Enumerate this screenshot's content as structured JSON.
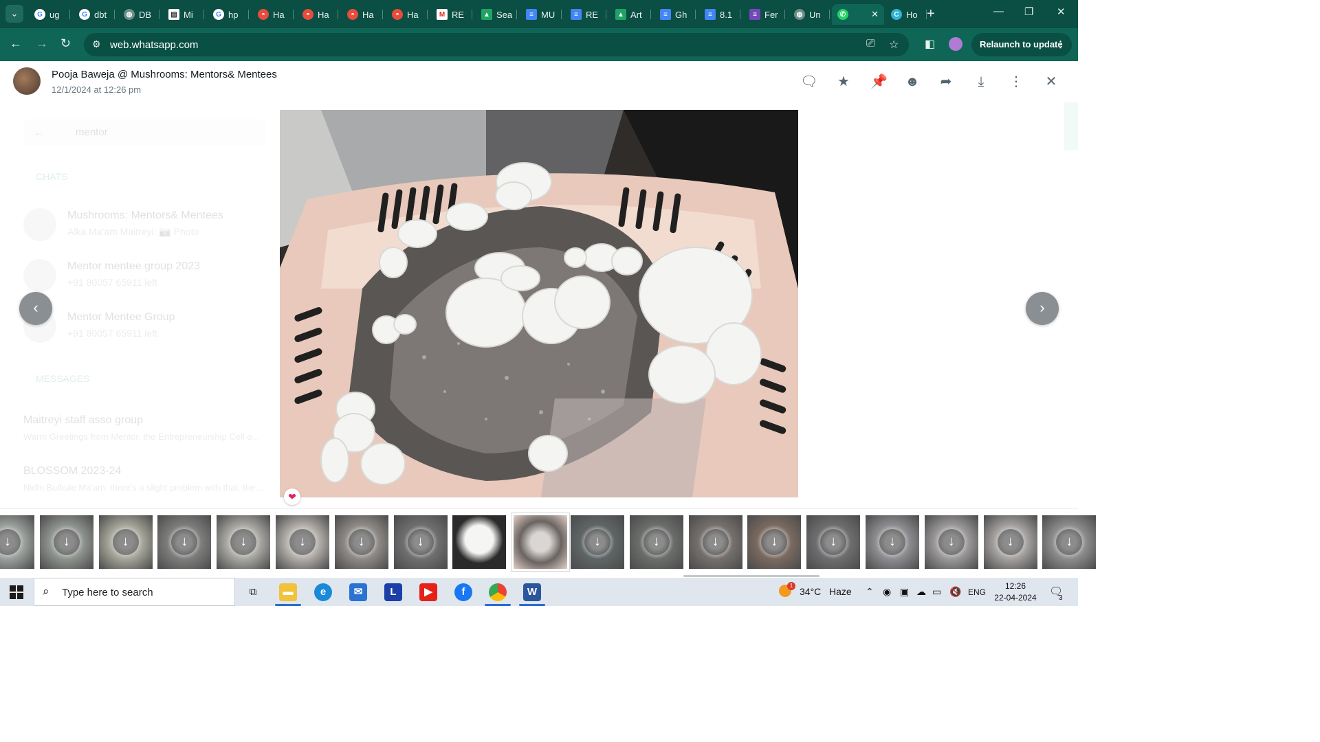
{
  "browser": {
    "tabs": [
      {
        "label": "ug",
        "icon": "google-icon"
      },
      {
        "label": "dbt",
        "icon": "google-icon"
      },
      {
        "label": "DB",
        "icon": "globe-icon"
      },
      {
        "label": "Mi",
        "icon": "slides-icon"
      },
      {
        "label": "hp",
        "icon": "google-icon"
      },
      {
        "label": "Ha",
        "icon": "genie-icon"
      },
      {
        "label": "Ha",
        "icon": "genie-icon"
      },
      {
        "label": "Ha",
        "icon": "genie-icon"
      },
      {
        "label": "Ha",
        "icon": "genie-icon"
      },
      {
        "label": "RE",
        "icon": "gmail-icon"
      },
      {
        "label": "Sea",
        "icon": "drive-icon"
      },
      {
        "label": "MU",
        "icon": "docs-icon"
      },
      {
        "label": "RE",
        "icon": "docs-icon"
      },
      {
        "label": "Art",
        "icon": "drive-icon"
      },
      {
        "label": "Gh",
        "icon": "docs-icon"
      },
      {
        "label": "8.1",
        "icon": "docs-icon"
      },
      {
        "label": "Fer",
        "icon": "forms-icon"
      },
      {
        "label": "Un",
        "icon": "globe-icon"
      },
      {
        "label": "",
        "icon": "whatsapp-icon",
        "active": true
      },
      {
        "label": "Ho",
        "icon": "canva-icon"
      }
    ],
    "url": "web.whatsapp.com",
    "relaunch_label": "Relaunch to update"
  },
  "viewer": {
    "sender": "Pooja Baweja @ Mushrooms: Mentors& Mentees",
    "timestamp": "12/1/2024 at 12:26 pm",
    "actions": [
      "message-icon",
      "star-icon",
      "pin-icon",
      "emoji-icon",
      "forward-icon",
      "download-icon",
      "more-icon",
      "close-icon"
    ],
    "reaction": "❤"
  },
  "background_chat": {
    "search_query": "mentor",
    "chats_label": "CHATS",
    "chats": [
      {
        "name": "Mushrooms: Mentors& Mentees",
        "subtitle": "Alka Ma'am Maitreyi: 📷 Photo"
      },
      {
        "name": "Mentor mentee group 2023",
        "subtitle": "+91 80057 65911 left"
      },
      {
        "name": "Mentor Mentee Group",
        "subtitle": "+91 80057 65911 left"
      }
    ],
    "messages_label": "MESSAGES",
    "messages": [
      {
        "name": "Maitreyi staff asso group",
        "subtitle": "Warm Greetings from Mentor, the Entrepreneurship Cell o..."
      },
      {
        "name": "BLOSSOM 2023-24",
        "subtitle": "Nidhi Bulbule Ma'am: there's a slight problem with that, the ..."
      }
    ]
  },
  "thumbnails": {
    "count": 19,
    "selected_index": 9,
    "loaded_index": 8
  },
  "taskbar": {
    "search_placeholder": "Type here to search",
    "apps": [
      "task-view-icon",
      "file-explorer-icon",
      "edge-icon",
      "mail-icon",
      "l-app-icon",
      "youtube-icon",
      "facebook-icon",
      "chrome-icon",
      "word-icon"
    ],
    "weather_temp": "34°C",
    "weather_desc": "Haze",
    "weather_badge": "1",
    "language": "ENG",
    "time": "12:26",
    "date": "22-04-2024",
    "notifications": "3"
  },
  "colors": {
    "tab_strip": "#0b4e43",
    "toolbar": "#0f6656",
    "whatsapp_green": "#00a884",
    "taskbar": "#dfe6ee"
  }
}
